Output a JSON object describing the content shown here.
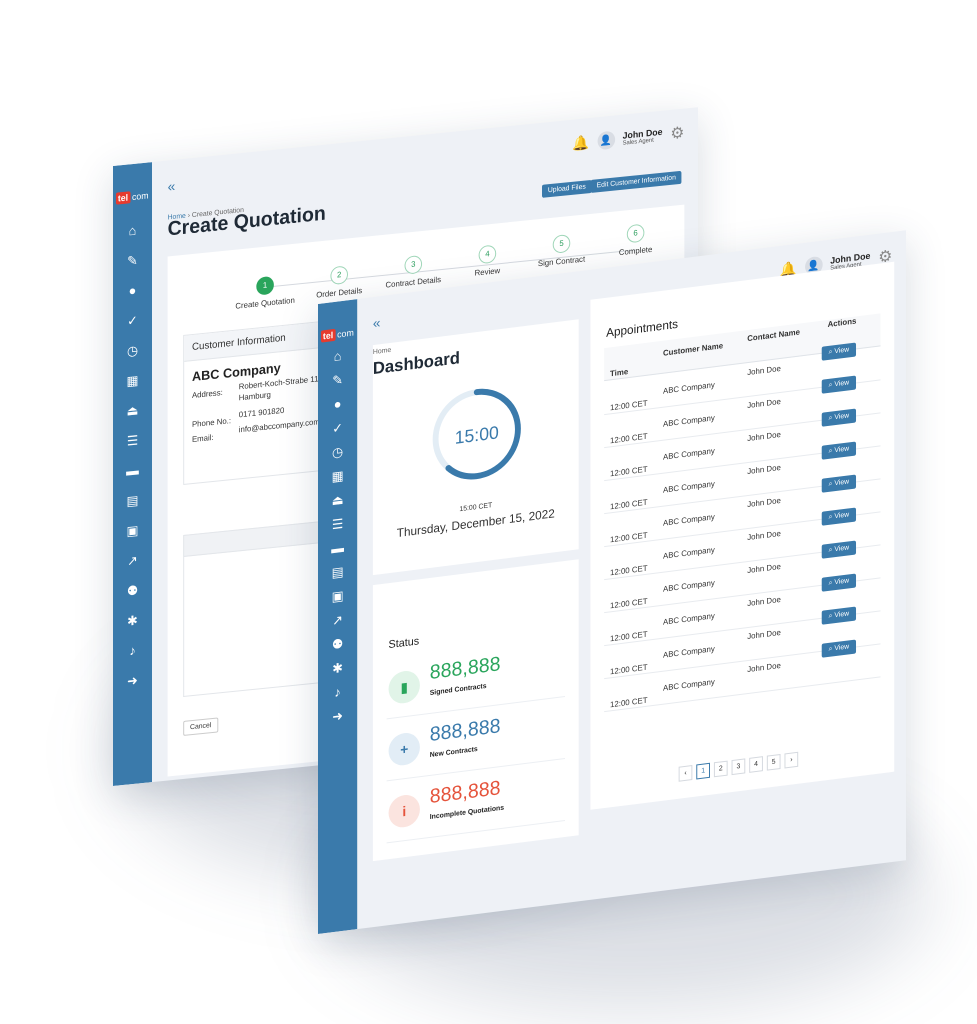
{
  "back_screen": {
    "logo": {
      "tel": "tel",
      "com": "com"
    },
    "user": {
      "name": "John Doe",
      "role": "Sales Agent"
    },
    "breadcrumb": {
      "home": "Home",
      "separator": "›",
      "current": "Create Quotation"
    },
    "title": "Create Quotation",
    "buttons": {
      "upload": "Upload Files",
      "edit_customer": "Edit Customer Information",
      "cancel": "Cancel"
    },
    "steps": [
      {
        "num": "1",
        "label": "Create Quotation"
      },
      {
        "num": "2",
        "label": "Order Details"
      },
      {
        "num": "3",
        "label": "Contract Details"
      },
      {
        "num": "4",
        "label": "Review"
      },
      {
        "num": "5",
        "label": "Sign Contract"
      },
      {
        "num": "6",
        "label": "Complete"
      }
    ],
    "customer": {
      "section_title": "Customer Information",
      "company": "ABC Company",
      "address_label": "Address:",
      "address_line1": "Robert-Koch-Strabe 11,",
      "address_line2": "Hamburg",
      "phone_label": "Phone No.:",
      "phone": "0171 901820",
      "email_label": "Email:",
      "email": "info@abccompany.com"
    }
  },
  "front_screen": {
    "logo": {
      "tel": "tel",
      "com": "com"
    },
    "user": {
      "name": "John Doe",
      "role": "Sales Agent"
    },
    "breadcrumb": {
      "home": "Home"
    },
    "title": "Dashboard",
    "clock": {
      "time": "15:00",
      "time_small": "15:00 CET",
      "date": "Thursday, December 15, 2022",
      "progress": 0.62
    },
    "status": {
      "title": "Status",
      "items": [
        {
          "value": "888,888",
          "label": "Signed Contracts",
          "color": "#2aa55c",
          "bg": "#e1f4e8",
          "icon": "document-icon"
        },
        {
          "value": "888,888",
          "label": "New Contracts",
          "color": "#3a7aab",
          "bg": "#e2edf6",
          "icon": "add-user-icon"
        },
        {
          "value": "888,888",
          "label": "Incomplete Quotations",
          "color": "#e5533b",
          "bg": "#fbe4df",
          "icon": "info-icon"
        }
      ]
    },
    "appointments": {
      "title": "Appointments",
      "headers": {
        "time": "Time",
        "customer": "Customer Name",
        "contact": "Contact Name",
        "actions": "Actions"
      },
      "view_label": "View",
      "rows": [
        {
          "time": "12:00 CET",
          "customer": "ABC Company",
          "contact": "John Doe"
        },
        {
          "time": "12:00 CET",
          "customer": "ABC Company",
          "contact": "John Doe"
        },
        {
          "time": "12:00 CET",
          "customer": "ABC Company",
          "contact": "John Doe"
        },
        {
          "time": "12:00 CET",
          "customer": "ABC Company",
          "contact": "John Doe"
        },
        {
          "time": "12:00 CET",
          "customer": "ABC Company",
          "contact": "John Doe"
        },
        {
          "time": "12:00 CET",
          "customer": "ABC Company",
          "contact": "John Doe"
        },
        {
          "time": "12:00 CET",
          "customer": "ABC Company",
          "contact": "John Doe"
        },
        {
          "time": "12:00 CET",
          "customer": "ABC Company",
          "contact": "John Doe"
        },
        {
          "time": "12:00 CET",
          "customer": "ABC Company",
          "contact": "John Doe"
        },
        {
          "time": "12:00 CET",
          "customer": "ABC Company",
          "contact": "John Doe"
        }
      ],
      "pagination": {
        "prev": "‹",
        "pages": [
          "1",
          "2",
          "3",
          "4",
          "5"
        ],
        "current": "1",
        "next": "›"
      }
    }
  },
  "nav_icons": [
    "home-icon",
    "edit-icon",
    "user-icon",
    "user-check-icon",
    "user-clock-icon",
    "calendar-icon",
    "eject-icon",
    "list-icon",
    "folder-icon",
    "book-icon",
    "contact-icon",
    "chart-icon",
    "users-icon",
    "settings-icon",
    "bell-icon",
    "logout-icon"
  ],
  "colors": {
    "primary": "#3a7aab",
    "success": "#2aa55c",
    "danger": "#e5533b",
    "logo_red": "#e63b2e"
  }
}
